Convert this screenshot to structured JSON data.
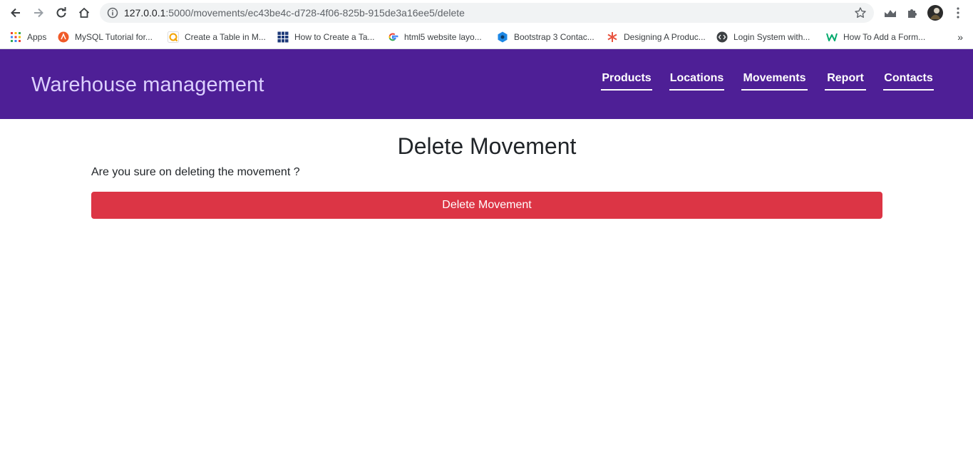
{
  "browser": {
    "url_host": "127.0.0.1",
    "url_rest": ":5000/movements/ec43be4c-d728-4f06-825b-915de3a16ee5/delete",
    "bookmarks": [
      {
        "label": "Apps",
        "icon": "apps-grid-icon"
      },
      {
        "label": "MySQL Tutorial for...",
        "icon": "mysql-tutorial-icon"
      },
      {
        "label": "Create a Table in M...",
        "icon": "create-table-icon"
      },
      {
        "label": "How to Create a Ta...",
        "icon": "table-grid-icon"
      },
      {
        "label": "html5 website layo...",
        "icon": "google-g-icon"
      },
      {
        "label": "Bootstrap 3 Contac...",
        "icon": "bootstrap-hex-icon"
      },
      {
        "label": "Designing A Produc...",
        "icon": "asterisk-icon"
      },
      {
        "label": "Login System with...",
        "icon": "code-brackets-icon"
      },
      {
        "label": "How To Add a Form...",
        "icon": "w-logo-icon"
      }
    ],
    "more_label": "»"
  },
  "app": {
    "brand": "Warehouse management",
    "nav": [
      "Products",
      "Locations",
      "Movements",
      "Report",
      "Contacts"
    ],
    "header_color": "#4e1f96"
  },
  "page": {
    "title": "Delete Movement",
    "confirm_text": "Are you sure on deleting the movement ?",
    "delete_button": "Delete Movement",
    "danger_color": "#dc3545"
  }
}
